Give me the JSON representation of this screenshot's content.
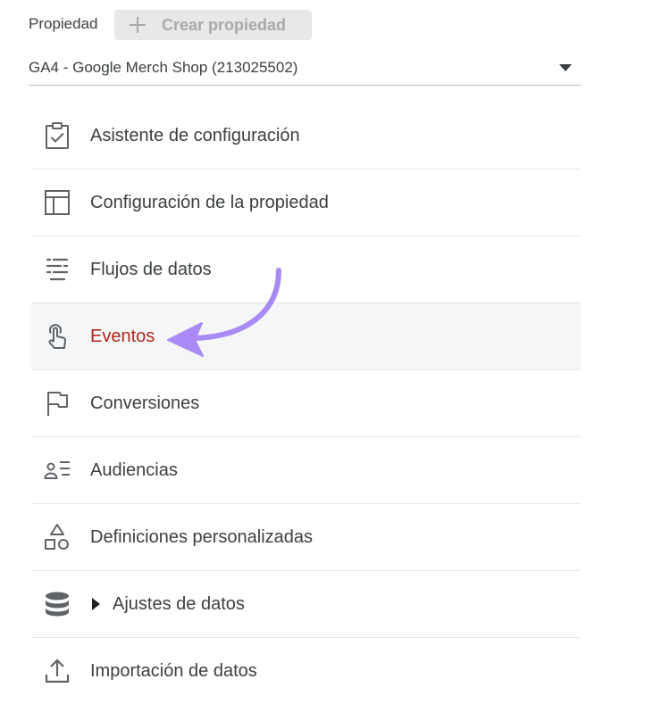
{
  "header": {
    "property_label": "Propiedad",
    "create_button": {
      "label": "Crear propiedad",
      "icon": "plus-icon"
    }
  },
  "property_select": {
    "value": "GA4 - Google Merch Shop (213025502)",
    "icon": "dropdown-caret-icon"
  },
  "menu": {
    "items": [
      {
        "label": "Asistente de configuración",
        "icon": "clipboard-check-icon",
        "active": false
      },
      {
        "label": "Configuración de la propiedad",
        "icon": "layout-panel-icon",
        "active": false
      },
      {
        "label": "Flujos de datos",
        "icon": "data-streams-icon",
        "active": false
      },
      {
        "label": "Eventos",
        "icon": "touch-hand-icon",
        "active": true
      },
      {
        "label": "Conversiones",
        "icon": "flag-icon",
        "active": false
      },
      {
        "label": "Audiencias",
        "icon": "audience-list-icon",
        "active": false
      },
      {
        "label": "Definiciones personalizadas",
        "icon": "shapes-icon",
        "active": false
      },
      {
        "label": "Ajustes de datos",
        "icon": "database-icon",
        "active": false,
        "expandable": true
      },
      {
        "label": "Importación de datos",
        "icon": "upload-icon",
        "active": false
      }
    ]
  },
  "colors": {
    "active_text": "#b3261e",
    "active_bg": "#f5f6f7",
    "annotation_arrow": "#a889f5",
    "icon": "#5f6368",
    "text": "#3c4043"
  }
}
